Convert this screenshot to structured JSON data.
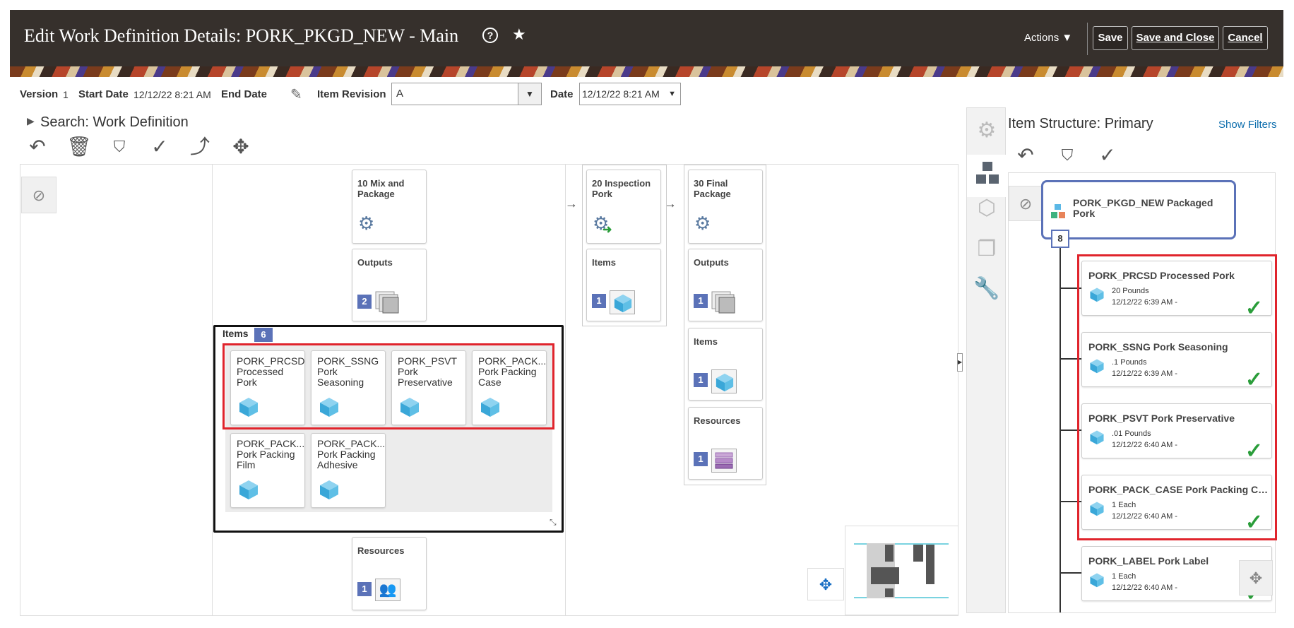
{
  "header": {
    "title": "Edit Work Definition Details: PORK_PKGD_NEW - Main",
    "actions_label": "Actions ▼",
    "save_label": "Save",
    "save_close_label": "Save and Close",
    "cancel_label": "Cancel"
  },
  "info_bar": {
    "version_label": "Version",
    "version_value": "1",
    "start_date_label": "Start Date",
    "start_date_value": "12/12/22 8:21 AM",
    "end_date_label": "End Date",
    "item_revision_label": "Item Revision",
    "item_revision_value": "A",
    "date_label": "Date",
    "date_value": "12/12/22 8:21 AM"
  },
  "search": {
    "label": "Search: Work Definition"
  },
  "operations": [
    {
      "title": "10 Mix and Package",
      "outputs_label": "Outputs",
      "outputs_count": "2",
      "items_label": "Items",
      "items_count": "6",
      "resources_label": "Resources",
      "resources_count": "1",
      "items": [
        {
          "label": "PORK_PRCSD Processed Pork"
        },
        {
          "label": "PORK_SSNG Pork Seasoning"
        },
        {
          "label": "PORK_PSVT Pork Preservative"
        },
        {
          "label": "PORK_PACK... Pork Packing Case"
        },
        {
          "label": "PORK_PACK... Pork Packing Film"
        },
        {
          "label": "PORK_PACK... Pork Packing Adhesive"
        }
      ]
    },
    {
      "title": "20 Inspection Pork",
      "items_label": "Items",
      "items_count": "1"
    },
    {
      "title": "30 Final Package",
      "outputs_label": "Outputs",
      "outputs_count": "1",
      "items_label": "Items",
      "items_count": "1",
      "resources_label": "Resources",
      "resources_count": "1"
    }
  ],
  "item_structure": {
    "title": "Item Structure: Primary",
    "show_filters": "Show Filters",
    "root": "PORK_PKGD_NEW Packaged Pork",
    "child_count": "8",
    "children": [
      {
        "title": "PORK_PRCSD Processed Pork",
        "qty": "20 Pounds",
        "date": "12/12/22 6:39 AM -"
      },
      {
        "title": "PORK_SSNG Pork Seasoning",
        "qty": ".1 Pounds",
        "date": "12/12/22 6:39 AM -"
      },
      {
        "title": "PORK_PSVT Pork Preservative",
        "qty": ".01 Pounds",
        "date": "12/12/22 6:40 AM -"
      },
      {
        "title": "PORK_PACK_CASE Pork Packing Case",
        "qty": "1 Each",
        "date": "12/12/22 6:40 AM -"
      },
      {
        "title": "PORK_LABEL Pork Label",
        "qty": "1 Each",
        "date": "12/12/22 6:40 AM -"
      }
    ]
  },
  "colors": {
    "header_bg": "#36302c",
    "highlight": "#e0242c",
    "count_badge": "#5b72b8",
    "check": "#2a9d3a",
    "link": "#0d6ead"
  }
}
